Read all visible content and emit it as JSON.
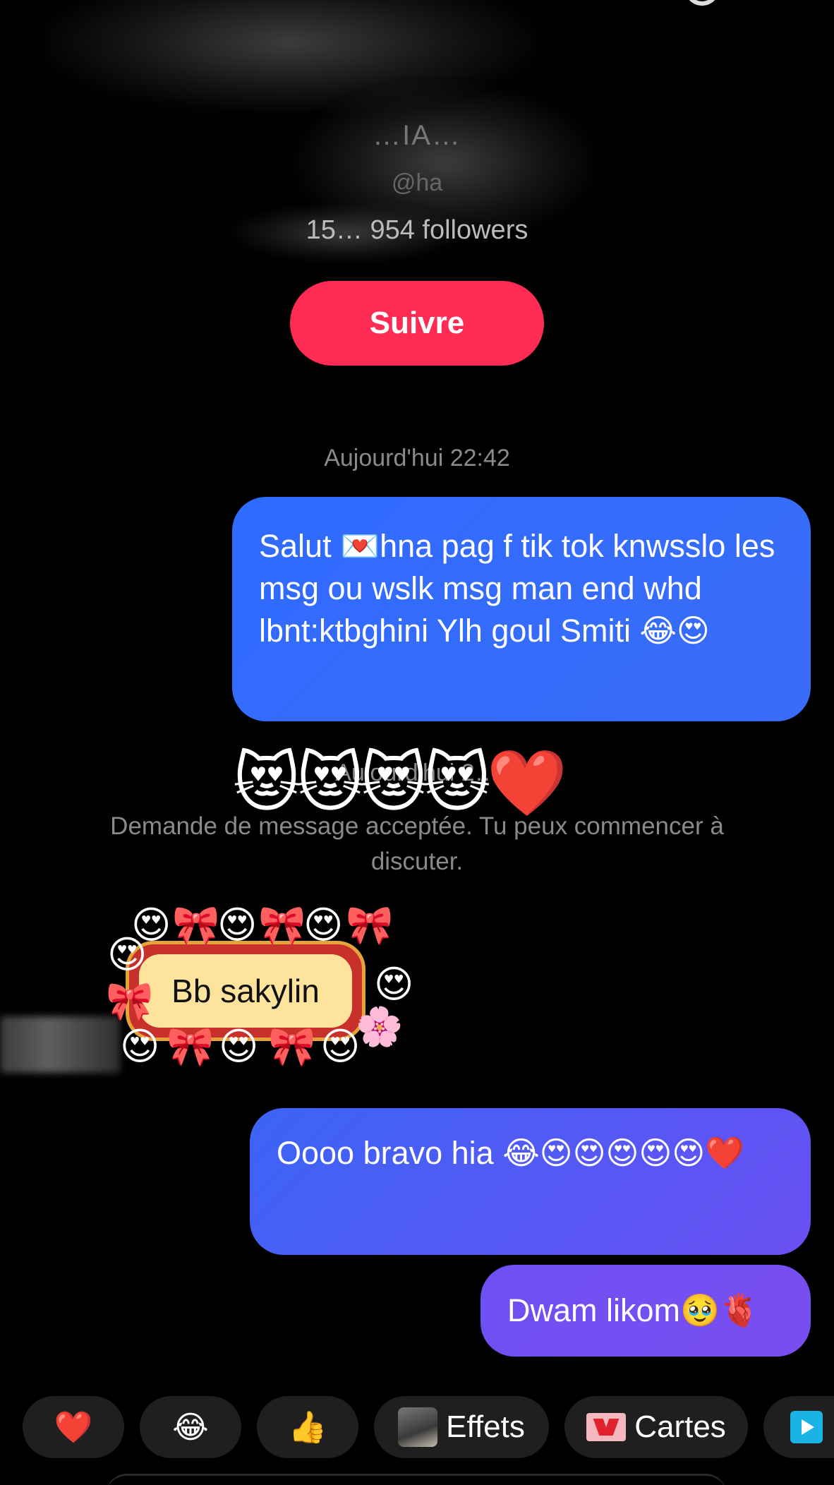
{
  "profile": {
    "name": "…IA…",
    "handle": "@ha",
    "stats": "15… 954 followers",
    "follow_label": "Suivre"
  },
  "conversation": {
    "timestamp_1": "Aujourd'hui 22:42",
    "message_1": "Salut 💌hna pag f tik tok knwsslo les msg ou wslk msg man end whd lbnt:ktbghini Ylh goul Smiti 😂😍",
    "reaction_emojis": "😻😻😻😻❤️",
    "timestamp_2": "Aujourd'hui 2…",
    "system_message": "Demande de message acceptée. Tu peux commencer à discuter.",
    "sticker_text": "Bb sakylin",
    "message_2": "Oooo bravo hia 😂😍😍😍😍😍❤️",
    "message_3": "Dwam likom🥹🫀"
  },
  "action_bar": {
    "heart": "❤️",
    "laugh": "😂",
    "thumbs": "👍",
    "effects_label": "Effets",
    "cards_label": "Cartes"
  },
  "colors": {
    "follow": "#fe2c55",
    "bubble_blue": "#2f6bff",
    "bubble_purple": "#6e50f2",
    "background": "#000000"
  }
}
